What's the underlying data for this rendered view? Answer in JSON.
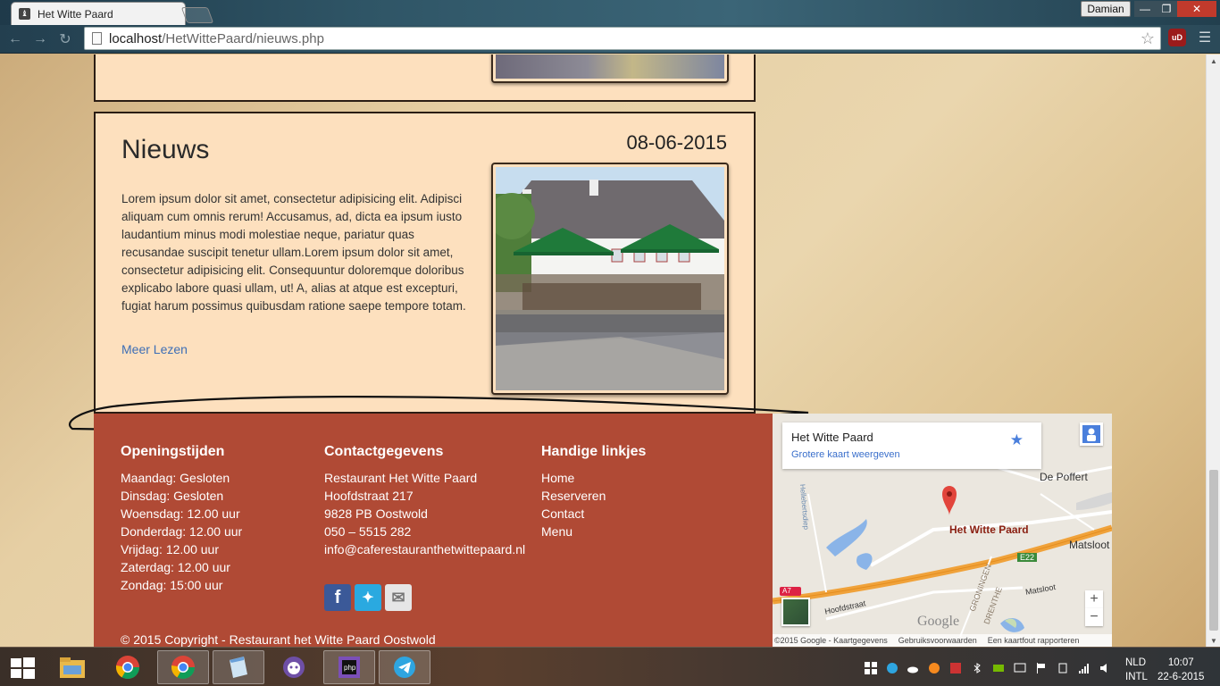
{
  "browser": {
    "tab_title": "Het Witte Paard",
    "user": "Damian",
    "url_host": "localhost",
    "url_path": "/HetWittePaard/nieuws.php",
    "extension_badge": "uD"
  },
  "news": {
    "title": "Nieuws",
    "date": "08-06-2015",
    "body": "Lorem ipsum dolor sit amet, consectetur adipisicing elit. Adipisci aliquam cum omnis rerum! Accusamus, ad, dicta ea ipsum iusto laudantium minus modi molestiae neque, pariatur quas recusandae suscipit tenetur ullam.Lorem ipsum dolor sit amet, consectetur adipisicing elit. Consequuntur doloremque doloribus explicabo labore quasi ullam, ut! A, alias at atque est excepturi, fugiat harum possimus quibusdam ratione saepe tempore totam.",
    "read_more": "Meer Lezen"
  },
  "footer": {
    "hours_title": "Openingstijden",
    "hours": [
      "Maandag: Gesloten",
      "Dinsdag: Gesloten",
      "Woensdag: 12.00 uur",
      "Donderdag: 12.00 uur",
      "Vrijdag: 12.00 uur",
      "Zaterdag: 12.00 uur",
      "Zondag: 15:00 uur"
    ],
    "contact_title": "Contactgegevens",
    "contact": [
      "Restaurant Het Witte Paard",
      "Hoofdstraat 217",
      "9828 PB Oostwold",
      "050 – 5515 282",
      "info@caferestauranthetwittepaard.nl"
    ],
    "links_title": "Handige linkjes",
    "links": [
      "Home",
      "Reserveren",
      "Contact",
      "Menu"
    ],
    "copyright": "© 2015 Copyright - Restaurant het Witte Paard Oostwold"
  },
  "map": {
    "place_name": "Het Witte Paard",
    "larger_map": "Grotere kaart weergeven",
    "marker_label": "Het Witte Paard",
    "labels": [
      "De Poffert",
      "Matsloot",
      "Matsloot",
      "Hoofdstraat",
      "E22",
      "GRONINGEN",
      "DRENTHE",
      "Hellebertsdiep",
      "A7"
    ],
    "footer": [
      "©2015 Google - Kaartgegevens",
      "Gebruiksvoorwaarden",
      "Een kaartfout rapporteren"
    ],
    "logo": "Google",
    "zoom_in": "+",
    "zoom_out": "−"
  },
  "taskbar": {
    "lang_1": "NLD",
    "lang_2": "INTL",
    "time": "10:07",
    "date": "22-6-2015"
  }
}
